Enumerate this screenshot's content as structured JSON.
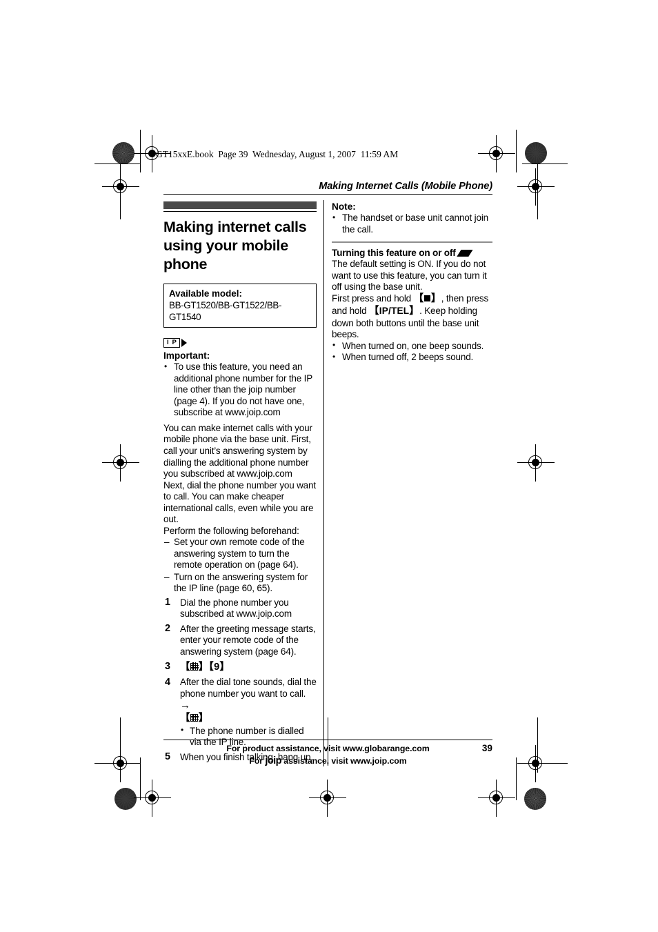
{
  "book_header": "GT15xxE.book  Page 39  Wednesday, August 1, 2007  11:59 AM",
  "running_head": "Making Internet Calls (Mobile Phone)",
  "left_column": {
    "section_title": "Making internet calls using your mobile phone",
    "model_box": {
      "label": "Available model:",
      "value": "BB-GT1520/BB-GT1522/BB-GT1540"
    },
    "ip_badge": "I P",
    "important_label": "Important:",
    "important_bullets": [
      "To use this feature, you need an additional phone number for the IP line other than the joip number (page 4). If you do not have one, subscribe at www.joip.com"
    ],
    "paragraphs": [
      "You can make internet calls with your mobile phone via the base unit. First, call your unit’s answering system by dialling the additional phone number you subscribed at www.joip.com",
      "Next, dial the phone number you want to call. You can make cheaper international calls, even while you are out.",
      "Perform the following beforehand:"
    ],
    "prep_items": [
      "Set your own remote code of the answering system to turn the remote operation on (page 64).",
      "Turn on the answering system for the IP line (page 60, 65)."
    ],
    "steps": [
      {
        "number": "1",
        "text": "Dial the phone number you subscribed at www.joip.com",
        "type": "text"
      },
      {
        "number": "2",
        "text": "After the greeting message starts, enter your remote code of the answering system (page 64).",
        "type": "text"
      },
      {
        "number": "3",
        "text": "",
        "type": "keys",
        "key_sequence_1": "hash-key",
        "key_digit": "9"
      },
      {
        "number": "4",
        "text": "After the dial tone sounds, dial the phone number you want to call.",
        "type": "text-keys",
        "arrow": "→",
        "key_after": "hash-key",
        "sub_bullets": [
          "The phone number is dialled via the IP line."
        ]
      },
      {
        "number": "5",
        "text": "When you finish talking, hang up.",
        "type": "text"
      }
    ]
  },
  "right_column": {
    "note_label": "Note:",
    "note_bullets": [
      "The handset or base unit cannot join the call."
    ],
    "sub_heading": "Turning this feature on or off",
    "sub_heading_icon": "base-unit-icon",
    "paragraphs": [
      "The default setting is ON. If you do not want to use this feature, you can turn it off using the base unit."
    ],
    "instruction_prefix": "First press and hold",
    "instruction_key_1": "stop-key",
    "instruction_middle": ", then press and hold",
    "instruction_key_2": "IP/TEL",
    "instruction_suffix": ". Keep holding down both buttons until the base unit beeps.",
    "result_bullets": [
      "When turned on, one beep sounds.",
      "When turned off, 2 beeps sound."
    ]
  },
  "footer": {
    "line1": "For product assistance, visit www.globarange.com",
    "line2_prefix": "For",
    "line2_brand": "joip",
    "line2_suffix": "assistance, visit www.joip.com",
    "page_number": "39"
  },
  "colors": {
    "title_bar": "#4a4a4a",
    "rule": "#000000",
    "gray_rule": "#8e8e8e"
  }
}
